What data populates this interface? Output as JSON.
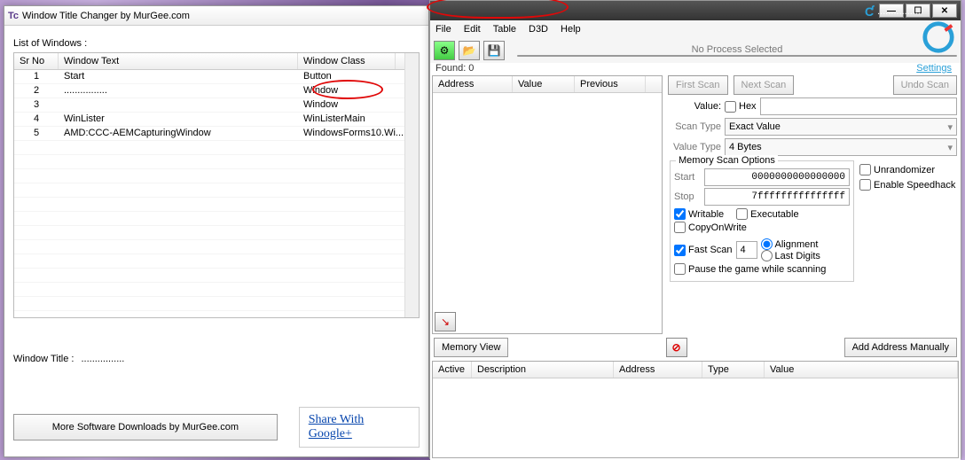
{
  "left": {
    "title": "Window Title Changer by MurGee.com",
    "listLabel": "List of Windows :",
    "headers": {
      "sr": "Sr No",
      "wt": "Window Text",
      "wc": "Window Class"
    },
    "rows": [
      {
        "sr": "1",
        "wt": "Start",
        "wc": "Button"
      },
      {
        "sr": "2",
        "wt": "................",
        "wc": "Window"
      },
      {
        "sr": "3",
        "wt": "",
        "wc": "Window"
      },
      {
        "sr": "4",
        "wt": "WinLister",
        "wc": "WinListerMain"
      },
      {
        "sr": "5",
        "wt": "AMD:CCC-AEMCapturingWindow",
        "wc": "WindowsForms10.Wi..."
      }
    ],
    "wtLabel": "Window Title :",
    "wtValue": "................",
    "moreBtn": "More Software Downloads by MurGee.com",
    "shareLink": "Share With Google+"
  },
  "right": {
    "title": "................",
    "menus": [
      "File",
      "Edit",
      "Table",
      "D3D",
      "Help"
    ],
    "noProcess": "No Process Selected",
    "found": "Found: 0",
    "settings": "Settings",
    "cols": {
      "addr": "Address",
      "val": "Value",
      "prev": "Previous"
    },
    "firstScan": "First Scan",
    "nextScan": "Next Scan",
    "undoScan": "Undo Scan",
    "valueLbl": "Value:",
    "hex": "Hex",
    "scanType": "Scan Type",
    "scanTypeVal": "Exact Value",
    "valueType": "Value Type",
    "valueTypeVal": "4 Bytes",
    "memOpts": "Memory Scan Options",
    "start": "Start",
    "startVal": "0000000000000000",
    "stop": "Stop",
    "stopVal": "7fffffffffffffff",
    "writable": "Writable",
    "executable": "Executable",
    "cow": "CopyOnWrite",
    "fastScan": "Fast Scan",
    "fastVal": "4",
    "alignment": "Alignment",
    "lastDigits": "Last Digits",
    "pause": "Pause the game while scanning",
    "unrand": "Unrandomizer",
    "speedhack": "Enable Speedhack",
    "memView": "Memory View",
    "addManual": "Add Address Manually",
    "tbl": {
      "active": "Active",
      "desc": "Description",
      "addr": "Address",
      "type": "Type",
      "val": "Value"
    }
  }
}
